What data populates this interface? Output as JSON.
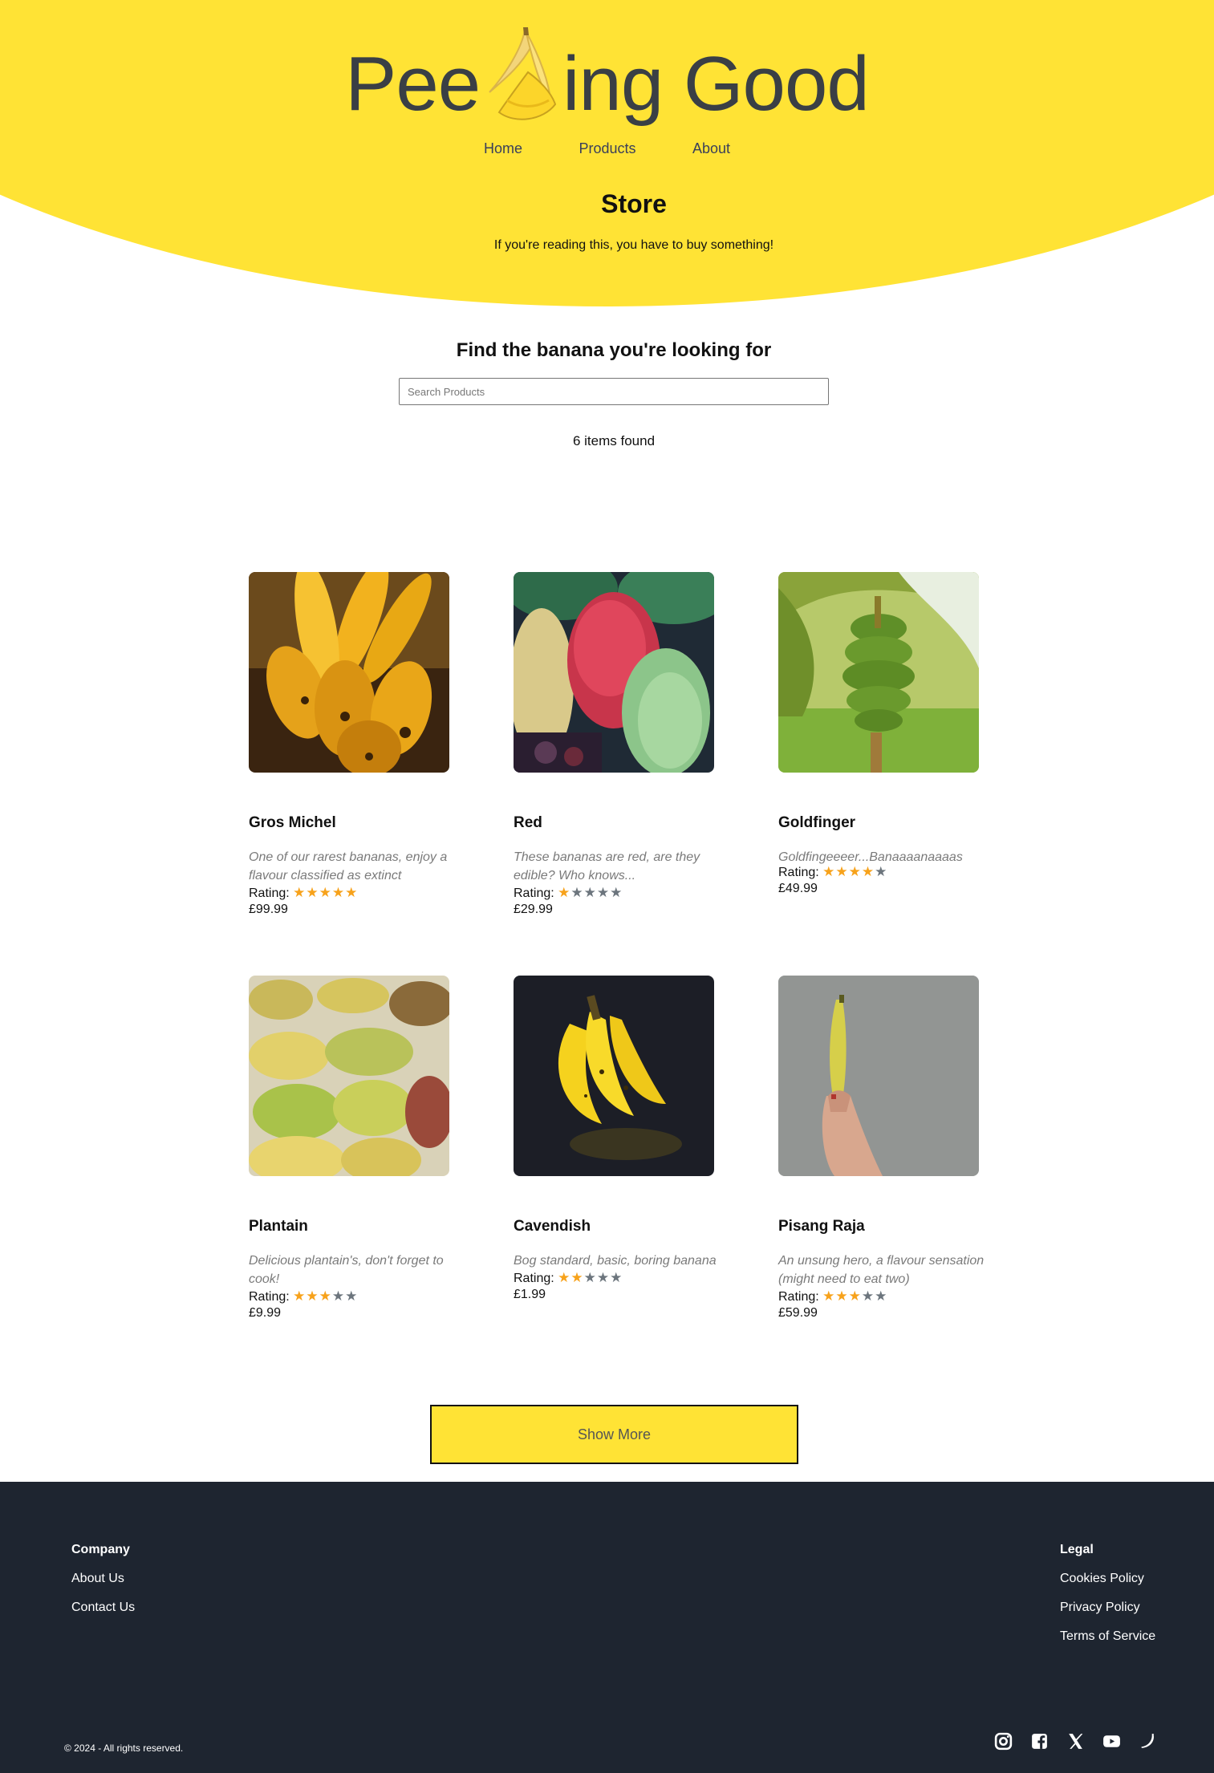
{
  "header": {
    "logo_left": "Pee",
    "logo_right": "ing Good",
    "nav": [
      "Home",
      "Products",
      "About"
    ],
    "page_title": "Store",
    "subtitle": "If you're reading this, you have to buy something!"
  },
  "search": {
    "heading": "Find the banana you're looking for",
    "placeholder": "Search Products",
    "value": "",
    "results_text": "6 items found"
  },
  "products": [
    {
      "name": "Gros Michel",
      "description": "One of our rarest bananas, enjoy a flavour classified as extinct",
      "rating_label": "Rating:",
      "rating": 5,
      "price": "£99.99",
      "image": "ripe-bananas-photo"
    },
    {
      "name": "Red",
      "description": "These bananas are red, are they edible? Who knows...",
      "rating_label": "Rating:",
      "rating": 1,
      "price": "£29.99",
      "image": "red-bananas-photo"
    },
    {
      "name": "Goldfinger",
      "description": "Goldfingeeeer...Banaaaanaaaas",
      "rating_label": "Rating:",
      "rating": 4,
      "price": "£49.99",
      "image": "banana-tree-photo"
    },
    {
      "name": "Plantain",
      "description": "Delicious plantain's, don't forget to cook!",
      "rating_label": "Rating:",
      "rating": 3,
      "price": "£9.99",
      "image": "market-bananas-photo"
    },
    {
      "name": "Cavendish",
      "description": "Bog standard, basic, boring banana",
      "rating_label": "Rating:",
      "rating": 2,
      "price": "£1.99",
      "image": "cavendish-bananas-photo"
    },
    {
      "name": "Pisang Raja",
      "description": "An unsung hero, a flavour sensation (might need to eat two)",
      "rating_label": "Rating:",
      "rating": 3,
      "price": "£59.99",
      "image": "hand-holding-banana-photo"
    }
  ],
  "show_more_label": "Show More",
  "footer": {
    "company_heading": "Company",
    "company_links": [
      "About Us",
      "Contact Us"
    ],
    "legal_heading": "Legal",
    "legal_links": [
      "Cookies Policy",
      "Privacy Policy",
      "Terms of Service"
    ],
    "copyright": "© 2024 - All rights reserved.",
    "socials": [
      "instagram-icon",
      "facebook-icon",
      "x-icon",
      "youtube-icon",
      "banana-icon"
    ]
  },
  "colors": {
    "brand_yellow": "#ffe335",
    "footer_bg": "#1e2530",
    "star_on": "#f7a21b",
    "star_off": "#6c757d"
  }
}
